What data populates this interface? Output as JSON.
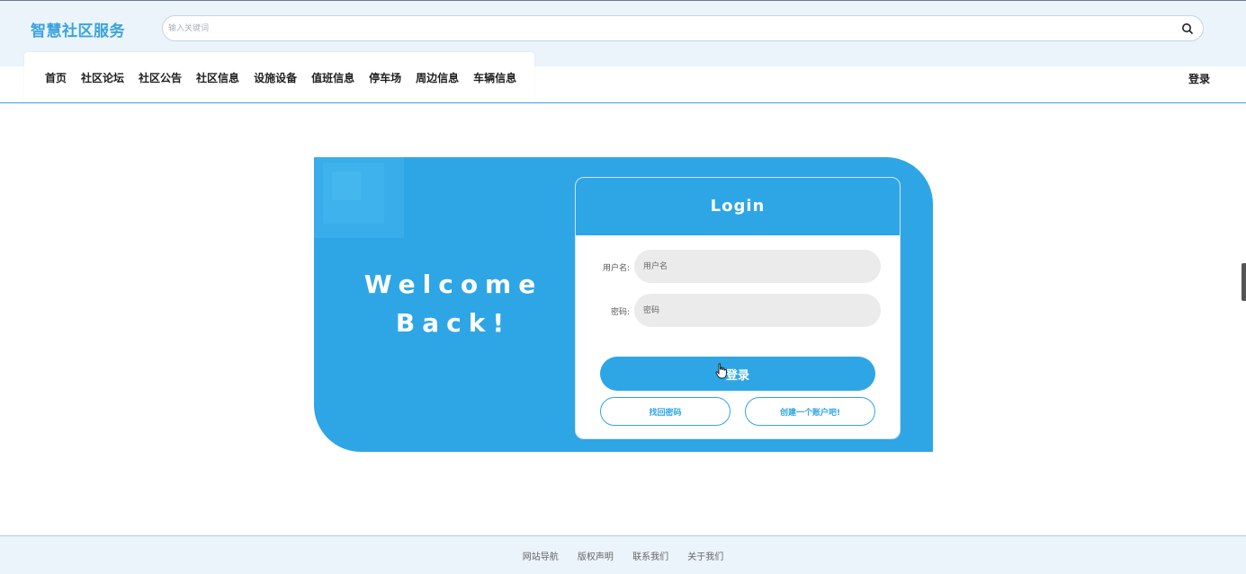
{
  "header": {
    "brand": "智慧社区服务",
    "search_placeholder": "输入关键词",
    "search_icon": "search-icon"
  },
  "nav": {
    "items": [
      "首页",
      "社区论坛",
      "社区公告",
      "社区信息",
      "设施设备",
      "值班信息",
      "停车场",
      "周边信息",
      "车辆信息"
    ],
    "login_label": "登录"
  },
  "hero": {
    "welcome_line1": "Welcome",
    "welcome_line2": "Back!"
  },
  "login_form": {
    "title": "Login",
    "username_label": "用户名:",
    "username_placeholder": "用户名",
    "password_label": "密码:",
    "password_placeholder": "密码",
    "submit_label": "登录",
    "forgot_label": "找回密码",
    "register_label": "创建一个账户吧!"
  },
  "footer": {
    "links": [
      "网站导航",
      "版权声明",
      "联系我们",
      "关于我们"
    ]
  },
  "colors": {
    "accent": "#2ea6e6",
    "brand": "#3aa3df",
    "header_bg": "#ebf4fb"
  }
}
